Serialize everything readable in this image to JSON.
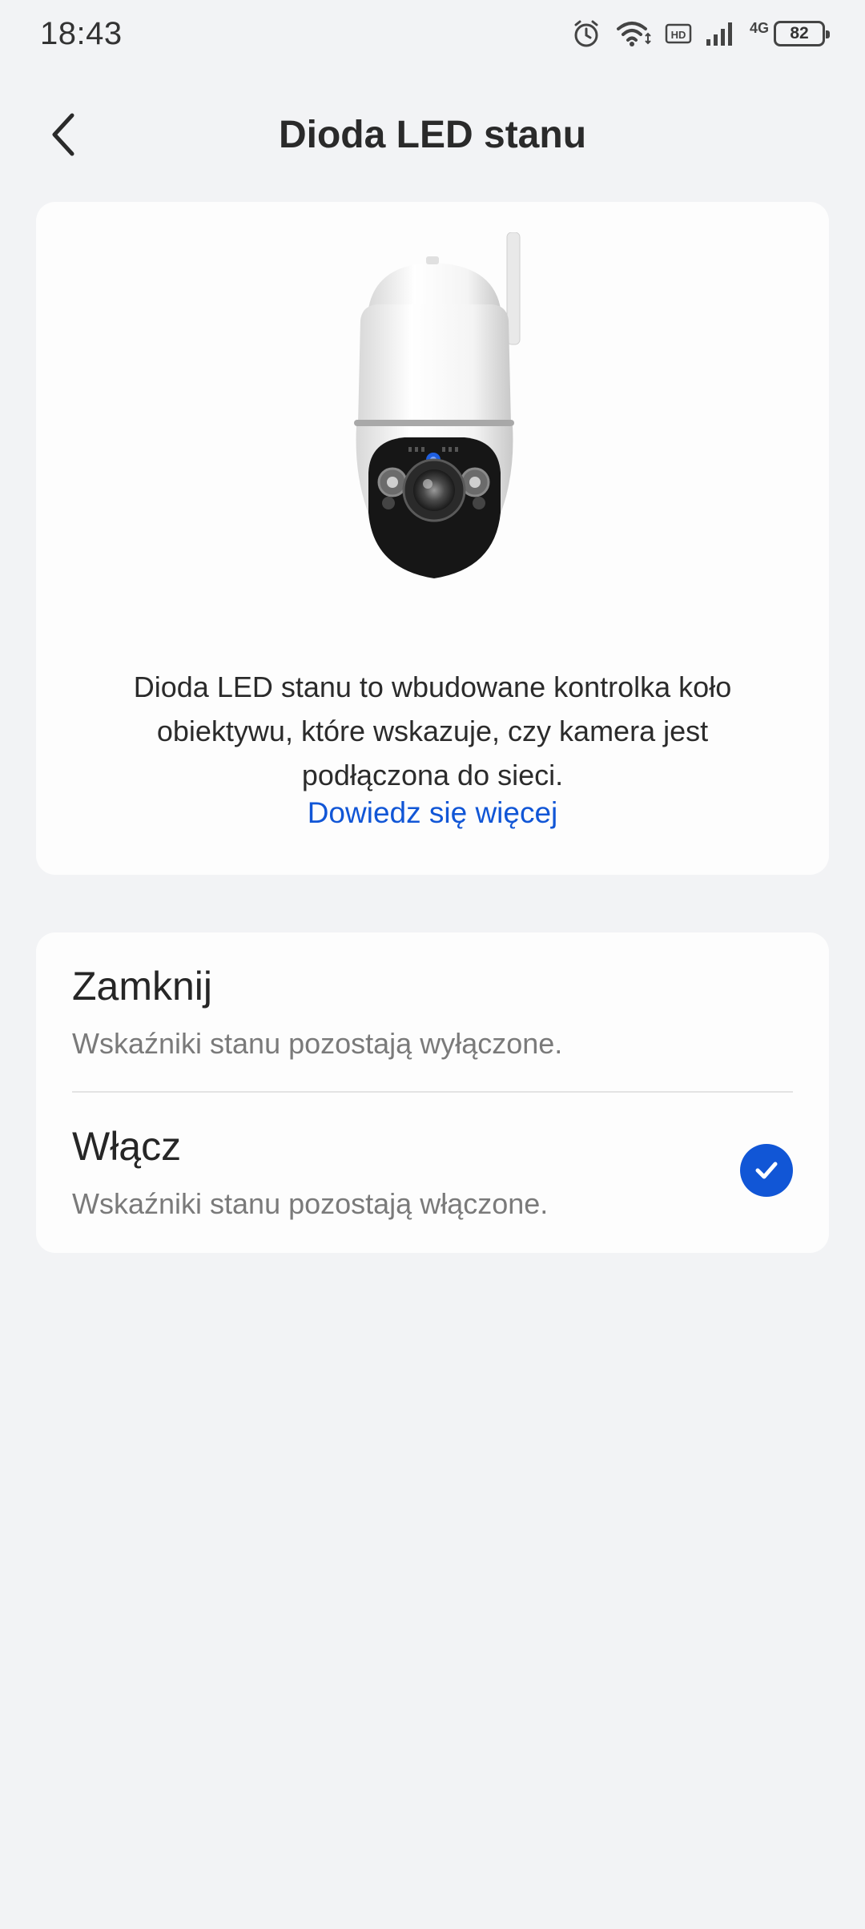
{
  "status_bar": {
    "time": "18:43",
    "network_label": "4G",
    "battery": "82",
    "icons": [
      "alarm-icon",
      "wifi-icon",
      "hd-icon",
      "signal-icon",
      "battery-icon"
    ]
  },
  "header": {
    "title": "Dioda LED stanu",
    "back_icon": "chevron-left-icon"
  },
  "info_card": {
    "image": "security-camera-image",
    "description": "Dioda LED stanu to wbudowane kontrolka koło obiektywu, które wskazuje, czy kamera jest podłączona do  sieci.",
    "learn_more": "Dowiedz się więcej"
  },
  "options": [
    {
      "title": "Zamknij",
      "description": "Wskaźniki stanu pozostają wyłączone.",
      "selected": false
    },
    {
      "title": "Włącz",
      "description": "Wskaźniki stanu pozostają włączone.",
      "selected": true
    }
  ],
  "colors": {
    "accent": "#1156d6",
    "background": "#f2f3f5",
    "card": "#fdfdfd"
  }
}
